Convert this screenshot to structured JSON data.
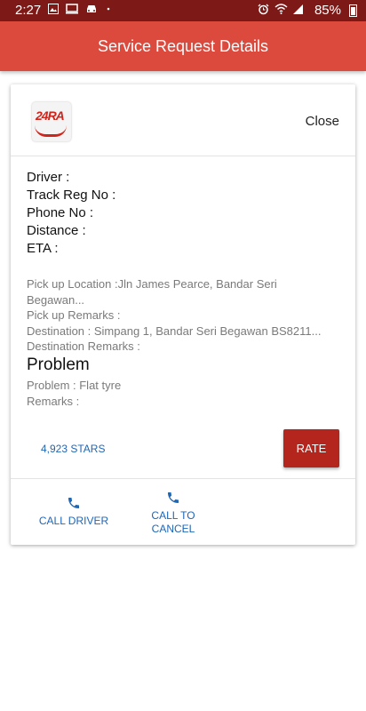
{
  "status_bar": {
    "time": "2:27",
    "battery": "85%",
    "icons": [
      "image-icon",
      "monitor-icon",
      "car-icon",
      "dot-icon",
      "alarm-icon",
      "wifi-icon",
      "signal-icon",
      "battery-icon"
    ]
  },
  "app_bar": {
    "title": "Service Request Details"
  },
  "card": {
    "logo_text": "24RA",
    "close_label": "Close",
    "driver_label": "Driver :",
    "track_reg_label": "Track Reg No :",
    "phone_label": "Phone No :",
    "distance_label": "Distance :",
    "eta_label": "ETA :",
    "pickup_location_line1": "Pick up Location :Jln James Pearce, Bandar Seri",
    "pickup_location_line2": "Begawan...",
    "pickup_remarks": "Pick up Remarks :",
    "destination": "Destination : Simpang 1, Bandar Seri Begawan BS8211...",
    "destination_remarks": "Destination Remarks :",
    "problem_heading": "Problem",
    "problem": "Problem : Flat tyre",
    "remarks": "Remarks :",
    "stars": "4,923 STARS",
    "rate_label": "RATE",
    "call_driver_label": "CALL DRIVER",
    "call_cancel_line1": "CALL TO",
    "call_cancel_line2": "CANCEL"
  },
  "colors": {
    "status_bar": "#7d1a17",
    "app_bar": "#dc4a3e",
    "rate_button": "#b3251d",
    "link_blue": "#1f66b5"
  }
}
